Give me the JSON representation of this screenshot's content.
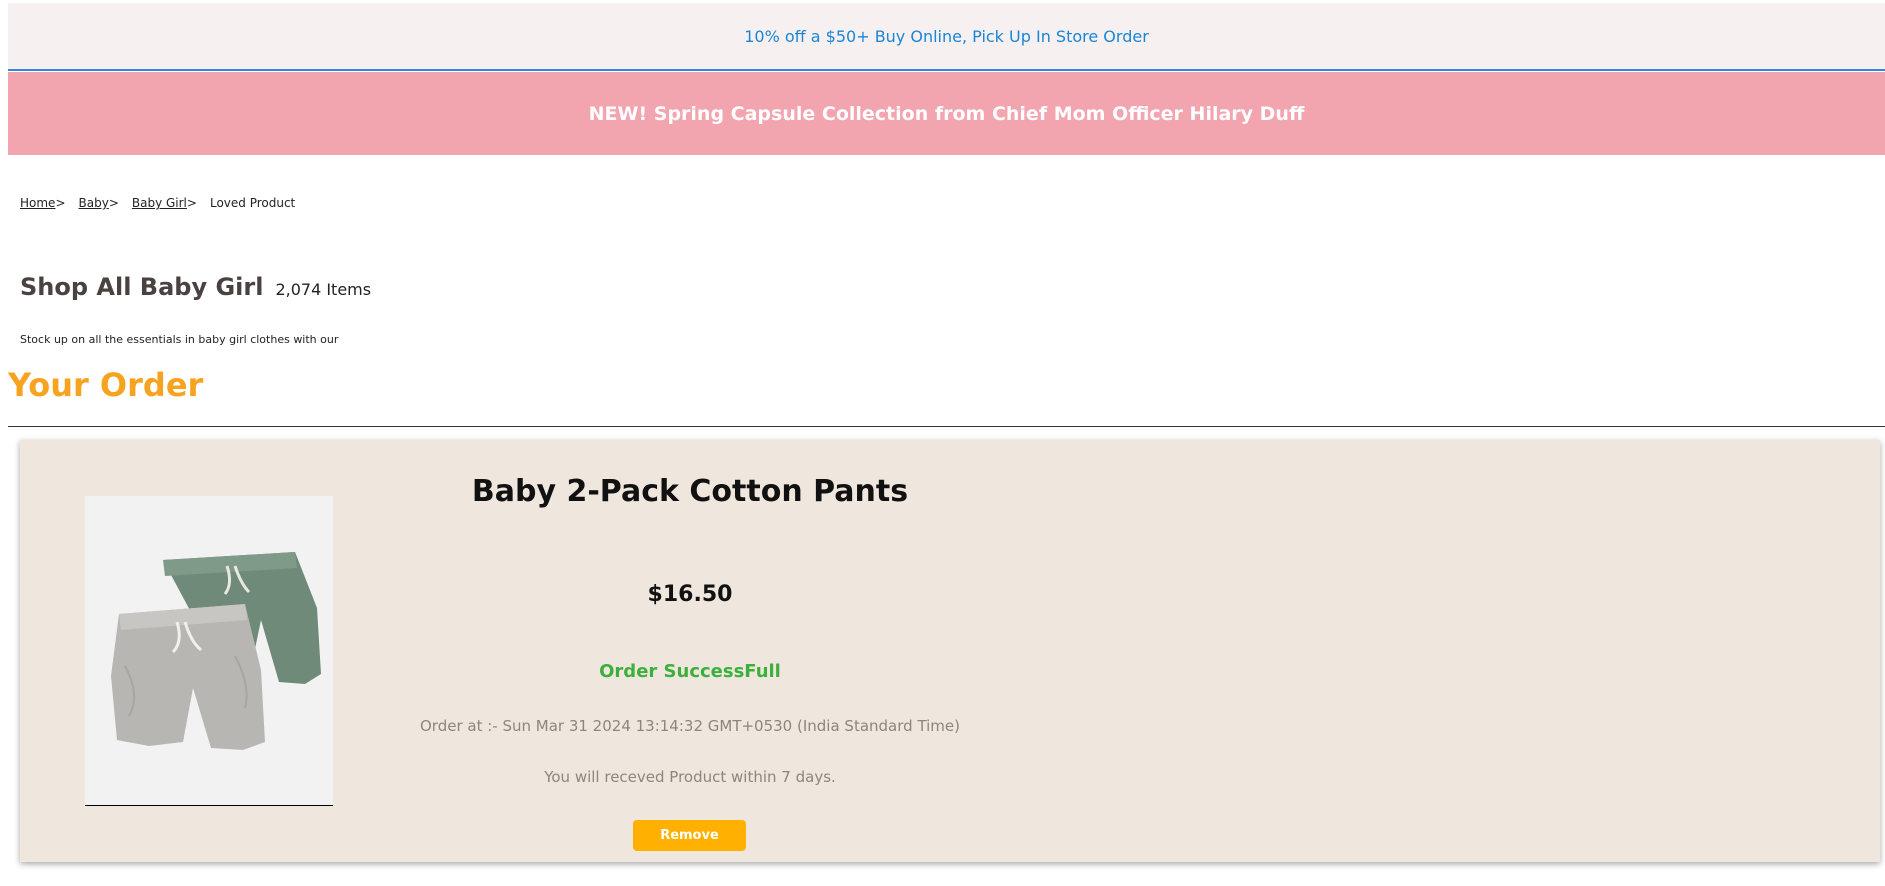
{
  "promo": {
    "text": "10% off a $50+ Buy Online, Pick Up In Store Order"
  },
  "banner": {
    "text": "NEW! Spring Capsule Collection from Chief Mom Officer Hilary Duff"
  },
  "breadcrumb": {
    "items": [
      {
        "label": "Home"
      },
      {
        "label": "Baby"
      },
      {
        "label": "Baby Girl"
      }
    ],
    "separator": ">",
    "current": "Loved Product"
  },
  "shop": {
    "title": "Shop All Baby Girl",
    "count": "2,074 Items",
    "description": "Stock up on all the essentials in baby girl clothes with our s"
  },
  "order": {
    "heading": "Your Order",
    "product_name": "Baby 2-Pack Cotton Pants",
    "price": "$16.50",
    "status": "Order SuccessFull",
    "ordered_at": "Order at :- Sun Mar 31 2024 13:14:32 GMT+0530 (India Standard Time)",
    "delivery_note": "You will receved Product within 7 days.",
    "remove_label": "Remove"
  },
  "colors": {
    "promo_link": "#1a85d6",
    "banner_bg": "#f2a4af",
    "order_heading": "#f8a31f",
    "card_bg": "#efe7dd",
    "status_green": "#3daf3d",
    "remove_button": "#ffb000"
  }
}
